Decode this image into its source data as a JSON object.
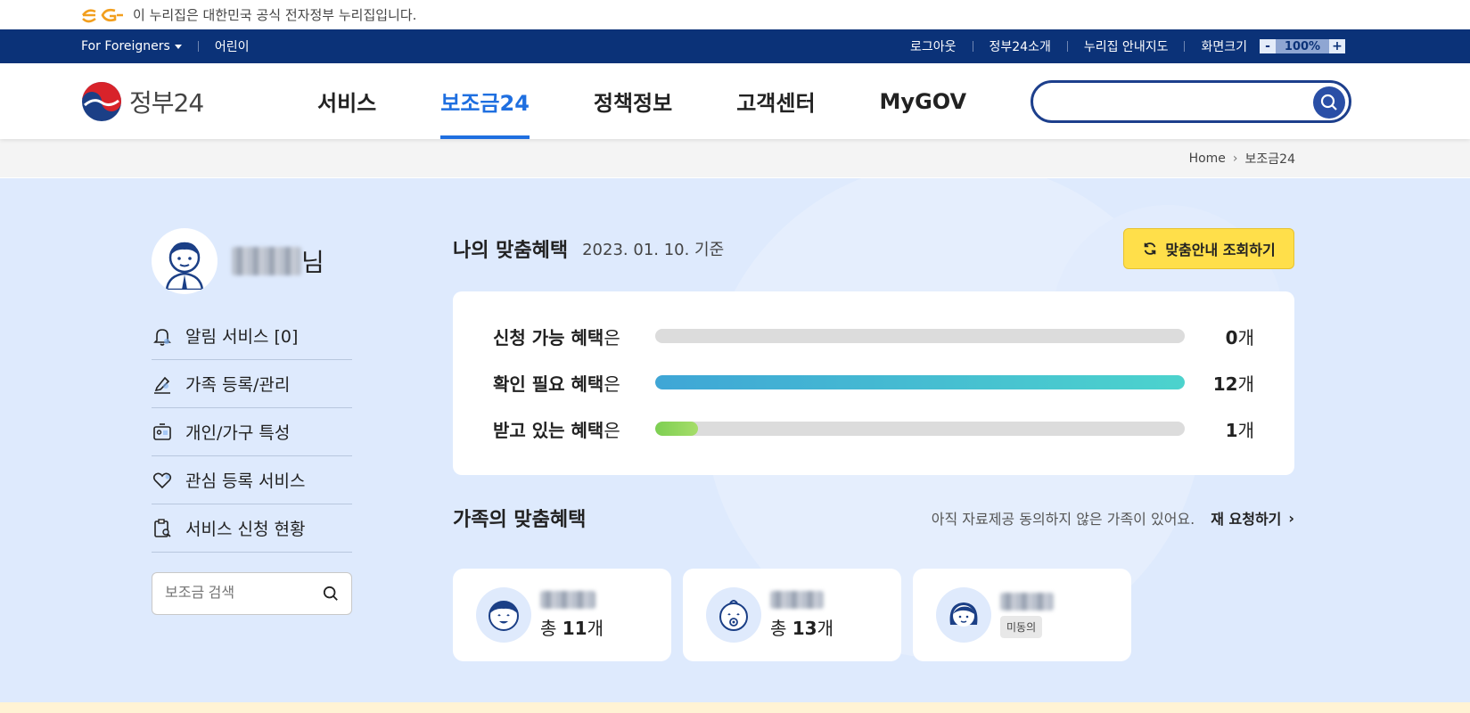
{
  "gov_banner": {
    "text": "이 누리집은 대한민국 공식 전자정부 누리집입니다.",
    "logo_icon": "eg-logo-icon"
  },
  "util_bar": {
    "left": [
      "For Foreigners",
      "어린이"
    ],
    "right": [
      "로그아웃",
      "정부24소개",
      "누리집 안내지도",
      "화면크기"
    ],
    "zoom": {
      "minus": "-",
      "value": "100%",
      "plus": "+"
    }
  },
  "nav": {
    "logo_text": "정부24",
    "menus": [
      "서비스",
      "보조금24",
      "정책정보",
      "고객센터",
      "MyGOV"
    ],
    "active_menu": "보조금24",
    "search_placeholder": ""
  },
  "breadcrumb": {
    "home": "Home",
    "current": "보조금24"
  },
  "sidebar": {
    "user_suffix": "님",
    "menu": [
      {
        "icon": "bell-icon",
        "label": "알림 서비스 [0]"
      },
      {
        "icon": "edit-icon",
        "label": "가족 등록/관리"
      },
      {
        "icon": "id-card-icon",
        "label": "개인/가구 특성"
      },
      {
        "icon": "heart-icon",
        "label": "관심 등록 서비스"
      },
      {
        "icon": "clipboard-search-icon",
        "label": "서비스 신청 현황"
      }
    ],
    "search_placeholder": "보조금 검색"
  },
  "my_benefits": {
    "title": "나의 맞춤혜택",
    "date": "2023. 01. 10. 기준",
    "refresh_button": "맞춤안내 조회하기",
    "rows": [
      {
        "label_bold": "신청 가능 혜택",
        "label_suffix": "은",
        "count": "0",
        "unit": "개",
        "progress": 0
      },
      {
        "label_bold": "확인 필요 혜택",
        "label_suffix": "은",
        "count": "12",
        "unit": "개",
        "progress": 1.0
      },
      {
        "label_bold": "받고 있는 혜택",
        "label_suffix": "은",
        "count": "1",
        "unit": "개",
        "progress": 0.08
      }
    ]
  },
  "family_benefits": {
    "title": "가족의 맞춤혜택",
    "note": "아직 자료제공 동의하지 않은 가족이 있어요.",
    "re_request": "재 요청하기",
    "members": [
      {
        "icon": "child-avatar-icon",
        "total_prefix": "총 ",
        "total": "11",
        "unit": "개"
      },
      {
        "icon": "baby-avatar-icon",
        "total_prefix": "총 ",
        "total": "13",
        "unit": "개"
      },
      {
        "icon": "woman-avatar-icon",
        "badge": "미동의"
      }
    ]
  },
  "colors": {
    "navy": "#0b3278",
    "accent_blue": "#1f6fe0",
    "content_bg": "#deeafd",
    "yellow": "#ffdf4a"
  }
}
